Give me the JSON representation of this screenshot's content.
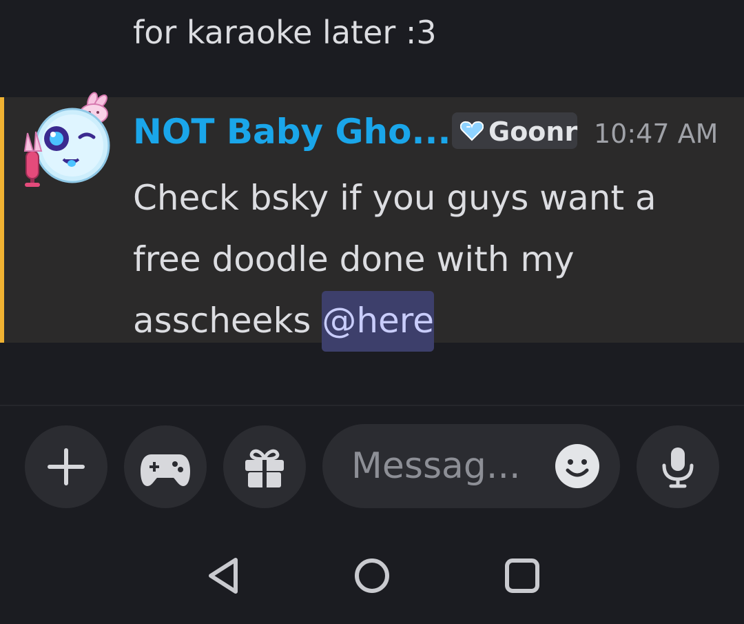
{
  "previous_message": {
    "text_tail": "for karaoke later :3"
  },
  "message": {
    "author": "NOT Baby Gho...",
    "role_tag": {
      "label": "Goonr",
      "icon": "blue-heart-icon",
      "icon_color": "#8fd3ff"
    },
    "timestamp": "10:47 AM",
    "text": "Check bsky if you guys want a free doodle done with my asscheeks",
    "mention": "@here",
    "highlight_bar_color": "#f0b232",
    "author_color": "#1aa6ea"
  },
  "composer": {
    "buttons": [
      {
        "icon": "plus-icon"
      },
      {
        "icon": "gamepad-icon"
      },
      {
        "icon": "gift-icon"
      }
    ],
    "placeholder": "Messag...",
    "emoji_icon": "smiley-icon",
    "mic_icon": "microphone-icon"
  },
  "system_nav": {
    "back_icon": "back-triangle-icon",
    "home_icon": "home-circle-icon",
    "recents_icon": "recents-square-icon"
  }
}
